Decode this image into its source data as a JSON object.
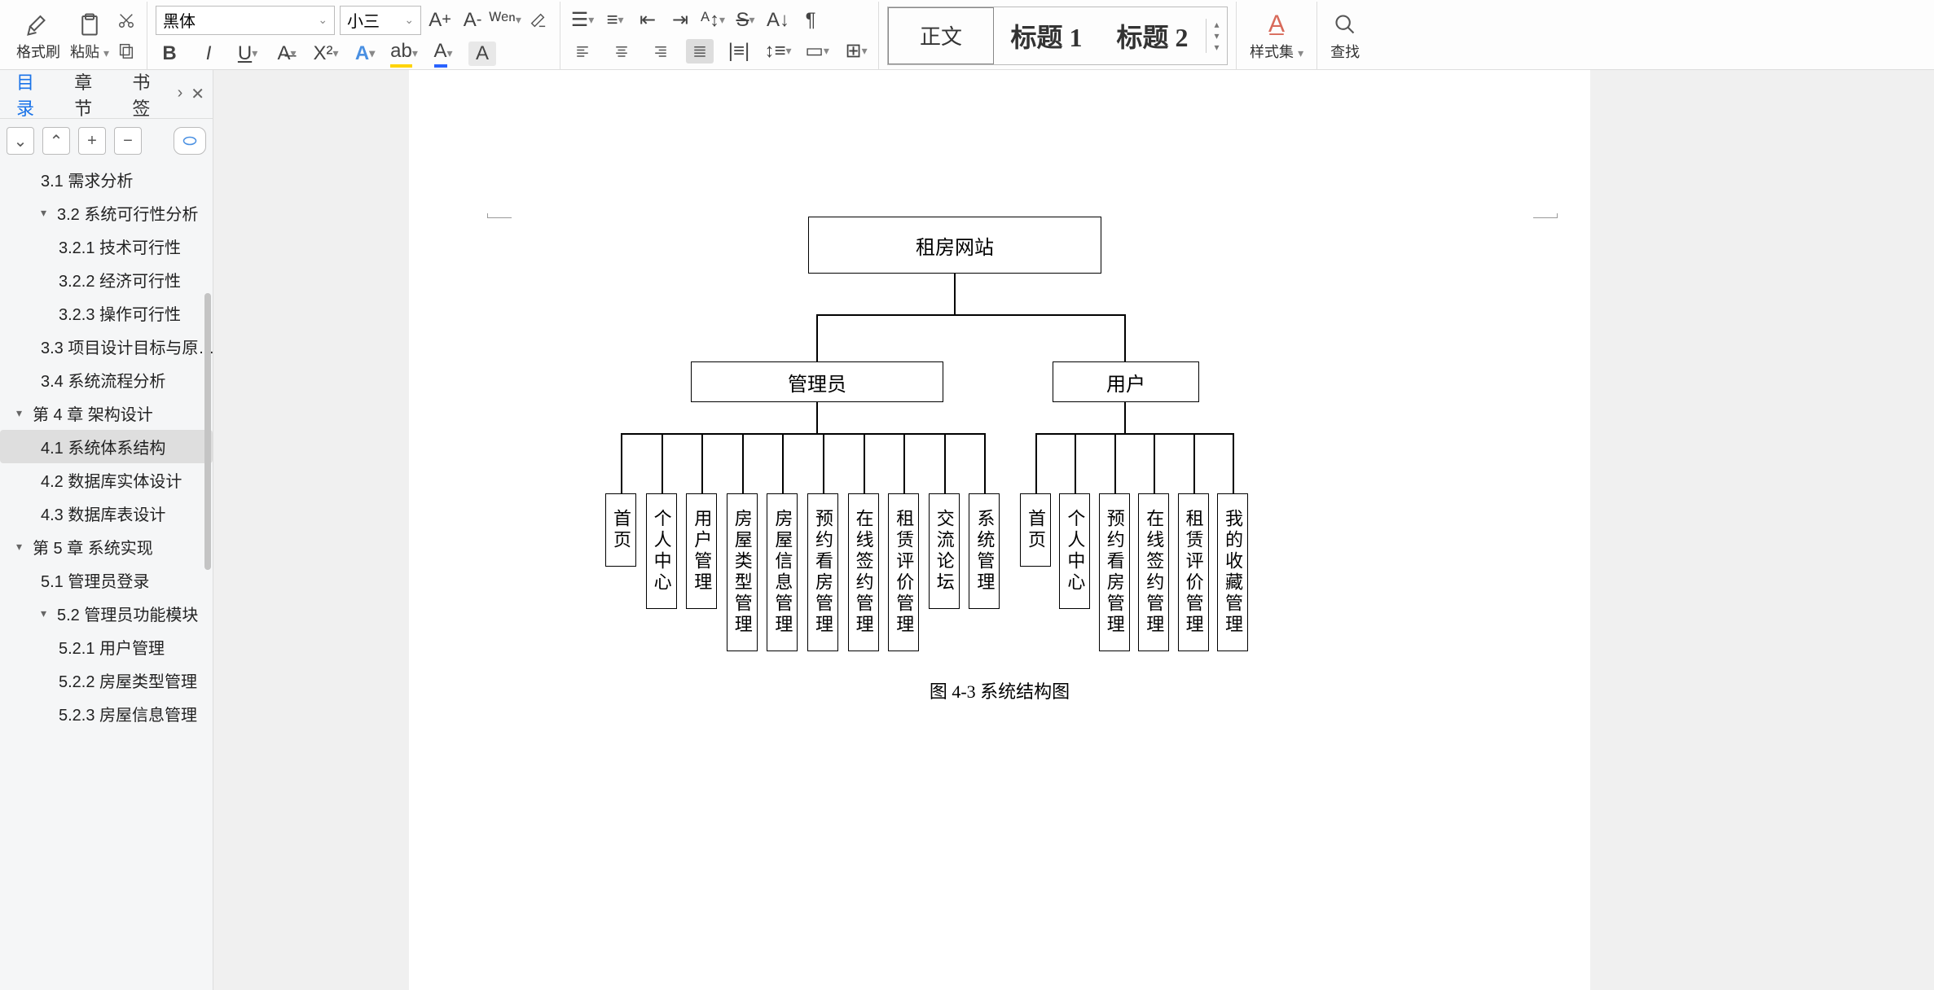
{
  "toolbar": {
    "format_painter": "格式刷",
    "paste": "粘贴",
    "font_name": "黑体",
    "font_size": "小三",
    "style_set": "样式集",
    "find": "查找",
    "styles": {
      "normal": "正文",
      "h1": "标题 1",
      "h2": "标题 2"
    }
  },
  "sidepanel": {
    "tabs": {
      "toc": "目录",
      "chapter": "章节",
      "bookmark": "书签"
    },
    "outline": {
      "i0": "3.1   需求分析",
      "i1": "3.2   系统可行性分析",
      "i2": "3.2.1 技术可行性",
      "i3": "3.2.2 经济可行性",
      "i4": "3.2.3 操作可行性",
      "i5": "3.3   项目设计目标与原…",
      "i6": "3.4   系统流程分析",
      "i7": "第 4 章   架构设计",
      "i8": "4.1   系统体系结构",
      "i9": "4.2   数据库实体设计",
      "i10": "4.3   数据库表设计",
      "i11": "第 5 章   系统实现",
      "i12": "5.1   管理员登录",
      "i13": "5.2   管理员功能模块",
      "i14": "5.2.1 用户管理",
      "i15": "5.2.2 房屋类型管理",
      "i16": "5.2.3 房屋信息管理"
    }
  },
  "chart_data": {
    "type": "tree",
    "title": "租房网站",
    "children": [
      {
        "name": "管理员",
        "children": [
          "首页",
          "个人中心",
          "用户管理",
          "房屋类型管理",
          "房屋信息管理",
          "预约看房管理",
          "在线签约管理",
          "租赁评价管理",
          "交流论坛",
          "系统管理"
        ]
      },
      {
        "name": "用户",
        "children": [
          "首页",
          "个人中心",
          "预约看房管理",
          "在线签约管理",
          "租赁评价管理",
          "我的收藏管理"
        ]
      }
    ],
    "caption": "图 4-3  系统结构图"
  }
}
